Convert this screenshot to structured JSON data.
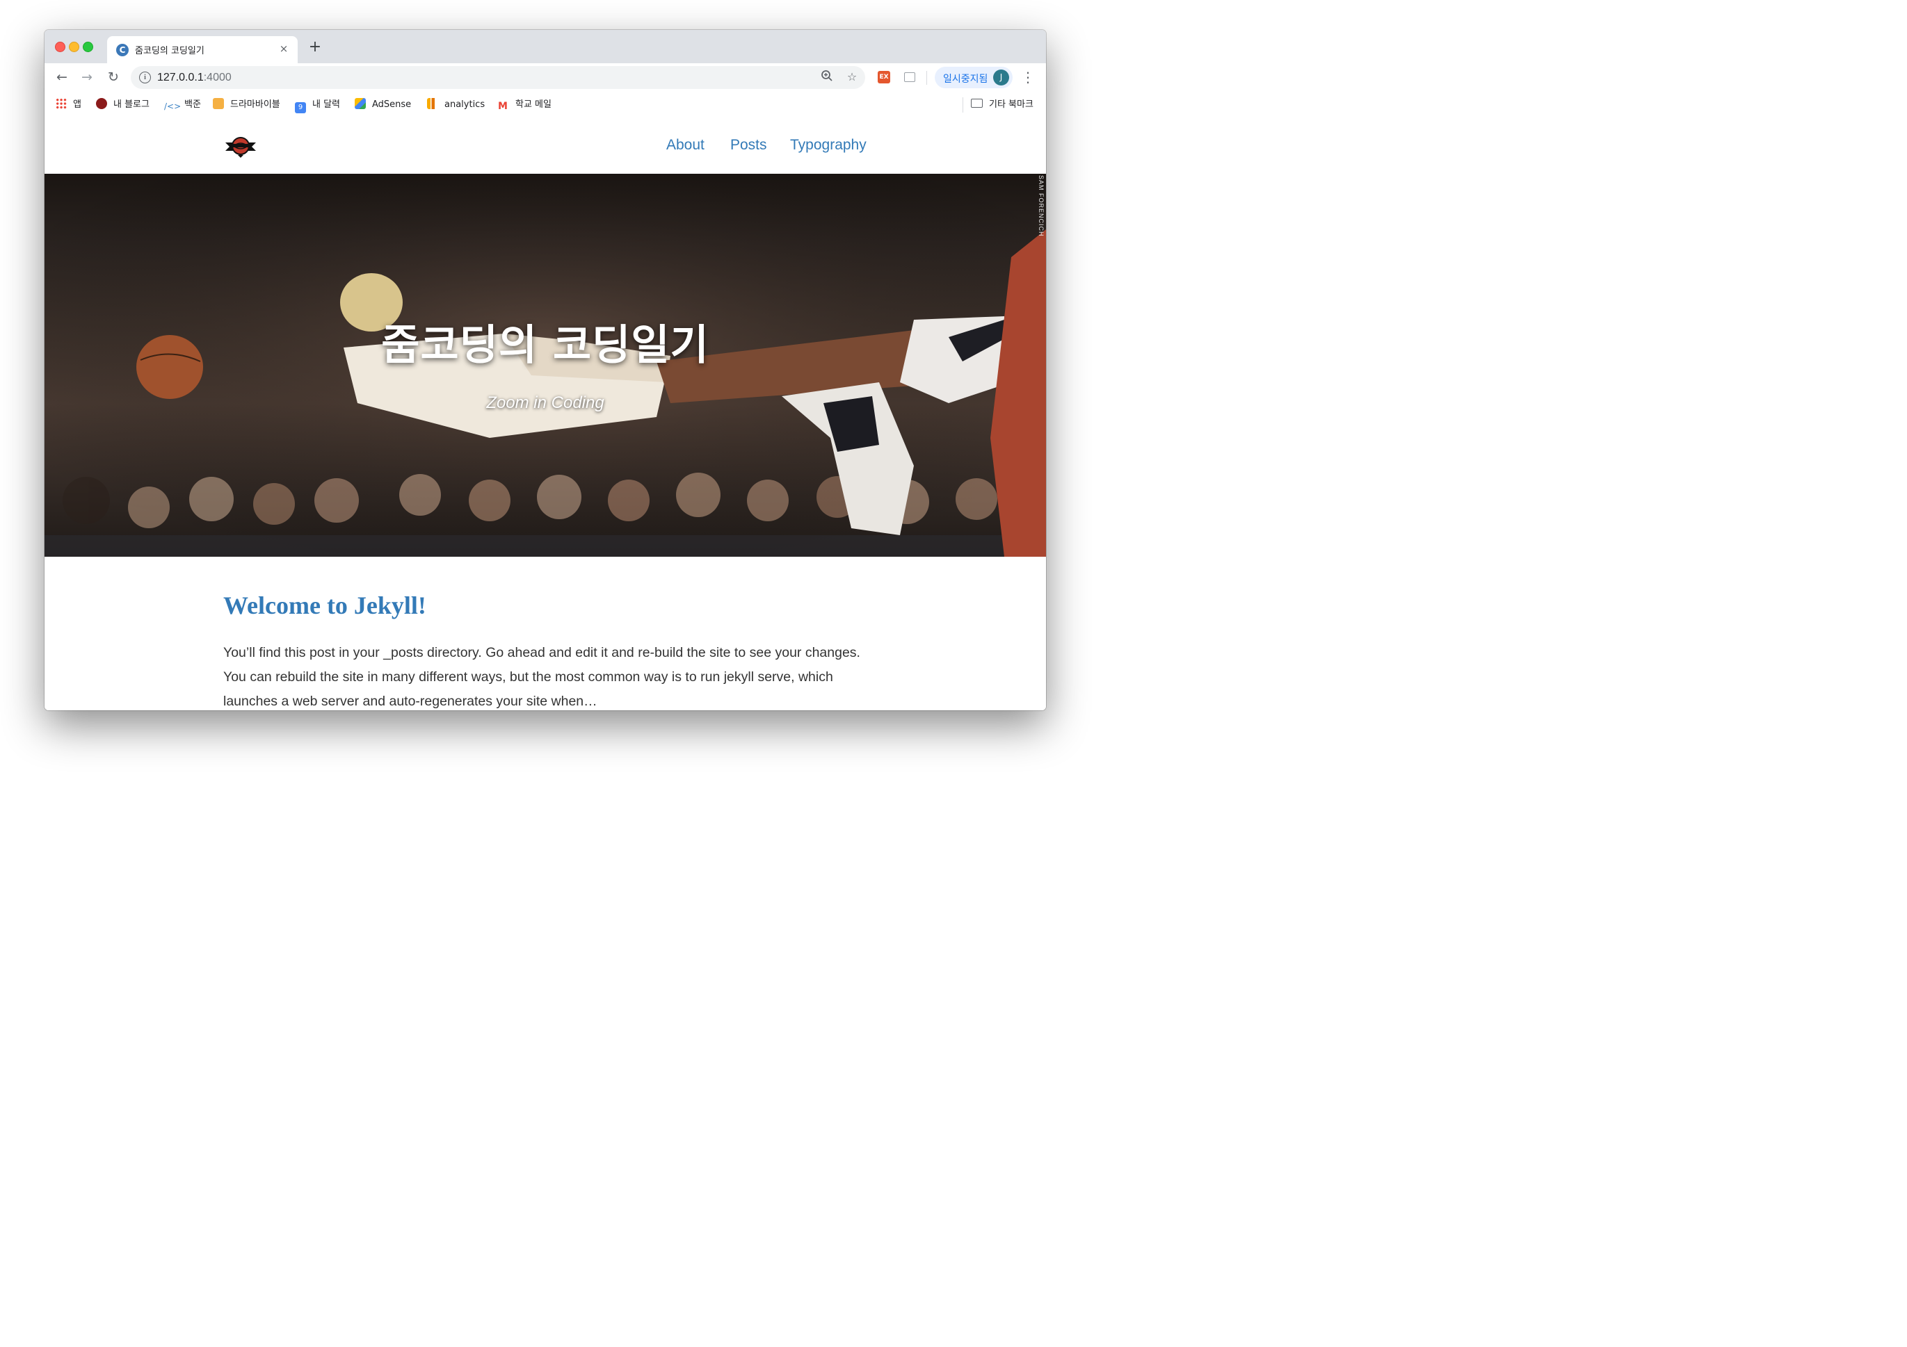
{
  "browser": {
    "tab": {
      "title": "줌코딩의 코딩일기",
      "favicon_letter": "C",
      "close_label": "×"
    },
    "new_tab_label": "+",
    "url": {
      "host": "127.0.0.1",
      "port": ":4000"
    },
    "profile": {
      "label": "일시중지됨",
      "avatar_letter": "J"
    },
    "extension_label": "EX"
  },
  "bookmarks": {
    "items": [
      {
        "label": "앱"
      },
      {
        "label": "내 블로그"
      },
      {
        "label": "백준"
      },
      {
        "label": "드라마바이블"
      },
      {
        "label": "내 달력"
      },
      {
        "label": "AdSense"
      },
      {
        "label": "analytics"
      },
      {
        "label": "학교 메일"
      }
    ],
    "other": "기타 북마크",
    "calendar_day": "9"
  },
  "site": {
    "nav": {
      "about": "About",
      "posts": "Posts",
      "typography": "Typography"
    },
    "hero": {
      "title": "줌코딩의 코딩일기",
      "subtitle": "Zoom in Coding",
      "photo_credit": "SAM FORENCICH"
    },
    "post": {
      "title": "Welcome to Jekyll!",
      "excerpt": "You’ll find this post in your _posts directory. Go ahead and edit it and re-build the site to see your changes. You can rebuild the site in many different ways, but the most common way is to run jekyll serve, which launches a web server and auto-regenerates your site when…"
    }
  },
  "colors": {
    "link": "#337ab7",
    "tabstrip": "#dee1e6"
  }
}
